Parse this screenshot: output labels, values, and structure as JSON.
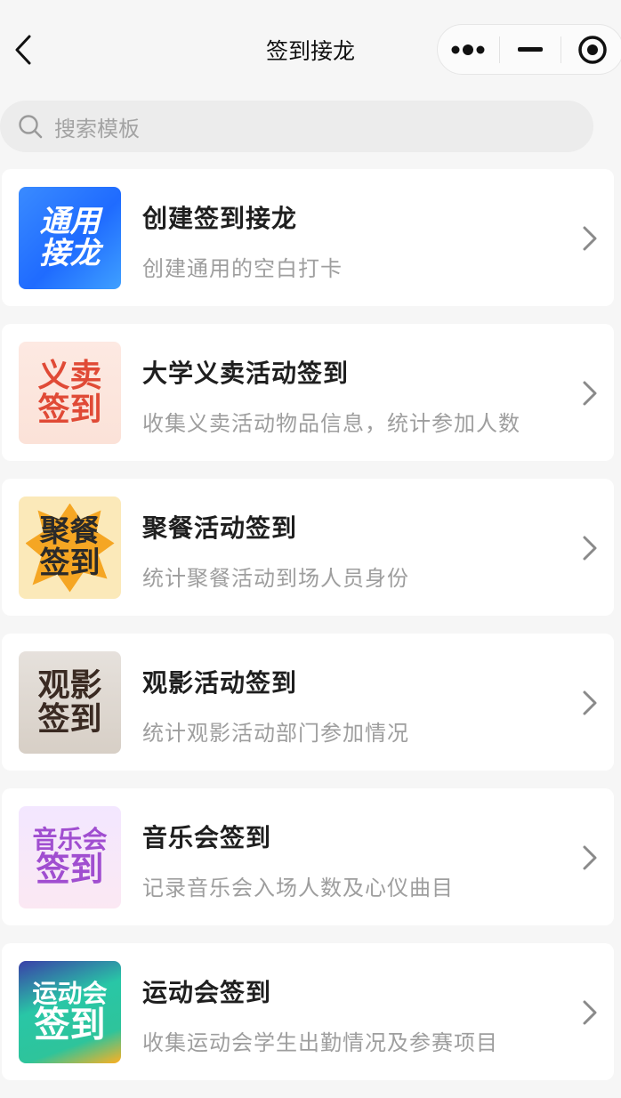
{
  "navbar": {
    "title": "签到接龙",
    "back_icon": "chevron-left-icon",
    "capsule": [
      "more-dots-icon",
      "minimize-icon",
      "target-icon"
    ]
  },
  "search": {
    "placeholder": "搜索模板",
    "icon": "search-icon"
  },
  "templates": [
    {
      "title": "创建签到接龙",
      "desc": "创建通用的空白打卡",
      "thumb_line1": "通用",
      "thumb_line2": "接龙",
      "accent": "#2f7bff"
    },
    {
      "title": "大学义卖活动签到",
      "desc": "收集义卖活动物品信息，统计参加人数",
      "thumb_line1": "义卖",
      "thumb_line2": "签到",
      "accent": "#e04a36"
    },
    {
      "title": "聚餐活动签到",
      "desc": "统计聚餐活动到场人员身份",
      "thumb_line1": "聚餐",
      "thumb_line2": "签到",
      "accent": "#f5a623"
    },
    {
      "title": "观影活动签到",
      "desc": "统计观影活动部门参加情况",
      "thumb_line1": "观影",
      "thumb_line2": "签到",
      "accent": "#3a2a22"
    },
    {
      "title": "音乐会签到",
      "desc": "记录音乐会入场人数及心仪曲目",
      "thumb_line1": "音乐会",
      "thumb_line2": "签到",
      "accent": "#a04ed0"
    },
    {
      "title": "运动会签到",
      "desc": "收集运动会学生出勤情况及参赛项目",
      "thumb_line1": "运动会",
      "thumb_line2": "签到",
      "accent": "#2ec49b"
    }
  ],
  "colors": {
    "background": "#f6f6f6",
    "card": "#ffffff",
    "title_text": "#1f1f1f",
    "desc_text": "#9e9e9e"
  }
}
